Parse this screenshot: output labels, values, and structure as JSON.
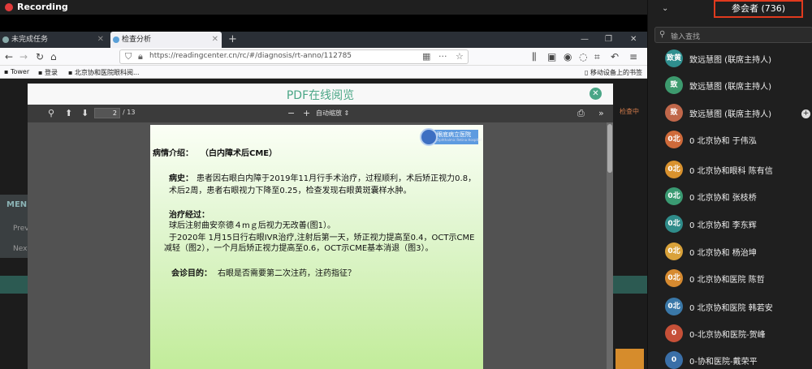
{
  "recording": {
    "label": "Recording"
  },
  "tabs": [
    {
      "label": "未完成任务"
    },
    {
      "label": "检查分析"
    }
  ],
  "new_tab_label": "+",
  "url": "https://readingcenter.cn/rc/#/diagnosis/rt-anno/112785",
  "bookmarks": {
    "tower": "Tower",
    "login": "登录",
    "site": "北京协和医院眼科阅...",
    "mobile": "移动设备上的书签"
  },
  "modal": {
    "title": "PDF在线阅览"
  },
  "pdf_toolbar": {
    "page_current": "2",
    "page_total": "/ 13",
    "zoom": "自动缩放"
  },
  "background_page": {
    "menu": "MEN",
    "prev": "Prev",
    "next": "Next",
    "status": "检查中"
  },
  "slide": {
    "logo_name": "眼底病立医院",
    "logo_sub": "Ophthalmic Retina Hospital",
    "heading_label": "病情介绍：",
    "heading_value": "（白内障术后CME）",
    "history_label": "病史：",
    "history_line1": "患者因右眼白内障于2019年11月行手术治疗，过程顺利，术后矫正视力0.8，",
    "history_line2": "术后2周，患者右眼视力下降至0.25，检查发现右眼黄斑囊样水肿。",
    "treatment_label": "治疗经过：",
    "treatment_line1": "球后注射曲安奈德４mｇ后视力无改善(图1）。",
    "treatment_line2": "于2020年 1月15日行右眼IVR治疗,注射后第一天，矫正视力提高至0.4，OCT示CME",
    "treatment_line3": "减轻（图2），一个月后矫正视力提高至0.6，OCT示CME基本消退（图3）。",
    "purpose_label": "会诊目的：",
    "purpose_value": "右眼是否需要第二次注药，注药指征？"
  },
  "participants": {
    "title": "参会者 (736)",
    "search_placeholder": "输入查找",
    "list": [
      {
        "avatar": "致黄",
        "name": "致远慧图 (联席主持人)",
        "color": "#2f8f8f"
      },
      {
        "avatar": "致",
        "name": "致远慧图 (联席主持人)",
        "color": "#3d9a6e"
      },
      {
        "avatar": "致",
        "name": "致远慧图 (联席主持人)",
        "color": "#c0674a"
      },
      {
        "avatar": "0北",
        "name": "0 北京协和 于伟泓",
        "color": "#cf6a3a"
      },
      {
        "avatar": "0北",
        "name": "0 北京协和眼科 陈有信",
        "color": "#d9922e"
      },
      {
        "avatar": "0北",
        "name": "0 北京协和 张枝桥",
        "color": "#3a9a72"
      },
      {
        "avatar": "0北",
        "name": "0 北京协和 李东辉",
        "color": "#2f8c8a"
      },
      {
        "avatar": "0北",
        "name": "0 北京协和 杨治坤",
        "color": "#d9a23a"
      },
      {
        "avatar": "0北",
        "name": "0 北京协和医院 陈哲",
        "color": "#d68a30"
      },
      {
        "avatar": "0北",
        "name": "0 北京协和医院 韩若安",
        "color": "#3a78a8"
      },
      {
        "avatar": "0",
        "name": "0-北京协和医院-贺峰",
        "color": "#c65038"
      },
      {
        "avatar": "0",
        "name": "0-协和医院-戴荣平",
        "color": "#3a6fa8"
      }
    ]
  },
  "colors": {
    "accent": "#4aa686",
    "highlight_border": "#e03a1e"
  }
}
